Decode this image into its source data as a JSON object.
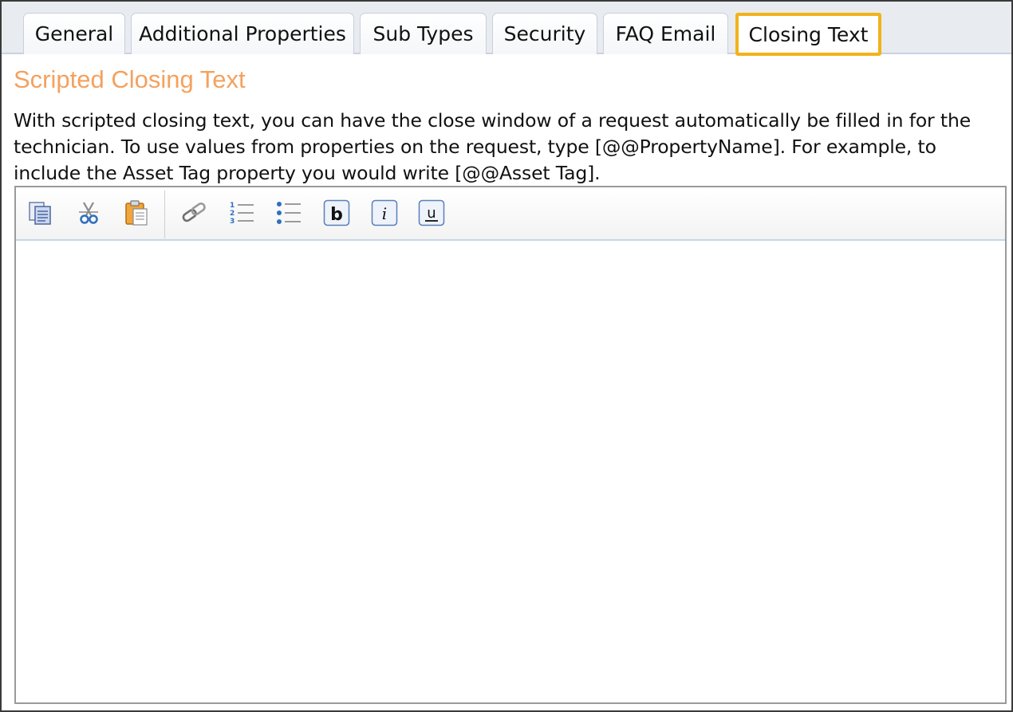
{
  "tabs": [
    {
      "label": "General"
    },
    {
      "label": "Additional Properties"
    },
    {
      "label": "Sub Types"
    },
    {
      "label": "Security"
    },
    {
      "label": "FAQ Email"
    },
    {
      "label": "Closing Text",
      "active": true
    }
  ],
  "section": {
    "heading": "Scripted Closing Text",
    "description": "With scripted closing text, you can have the close window of a request automatically be filled in for the technician. To use values from properties on the request, type [@@PropertyName]. For example, to include the Asset Tag property you would write [@@Asset Tag]."
  },
  "editor": {
    "toolbar": [
      {
        "icon": "copy-icon"
      },
      {
        "icon": "cut-icon"
      },
      {
        "icon": "paste-icon"
      },
      {
        "icon": "link-icon"
      },
      {
        "icon": "numbered-list-icon"
      },
      {
        "icon": "bulleted-list-icon"
      },
      {
        "icon": "bold-icon"
      },
      {
        "icon": "italic-icon"
      },
      {
        "icon": "underline-icon"
      }
    ],
    "content": ""
  },
  "colors": {
    "heading": "#f4a15e",
    "active_tab_border": "#f2b21a",
    "tabstrip_bg": "#e8ebf0"
  }
}
